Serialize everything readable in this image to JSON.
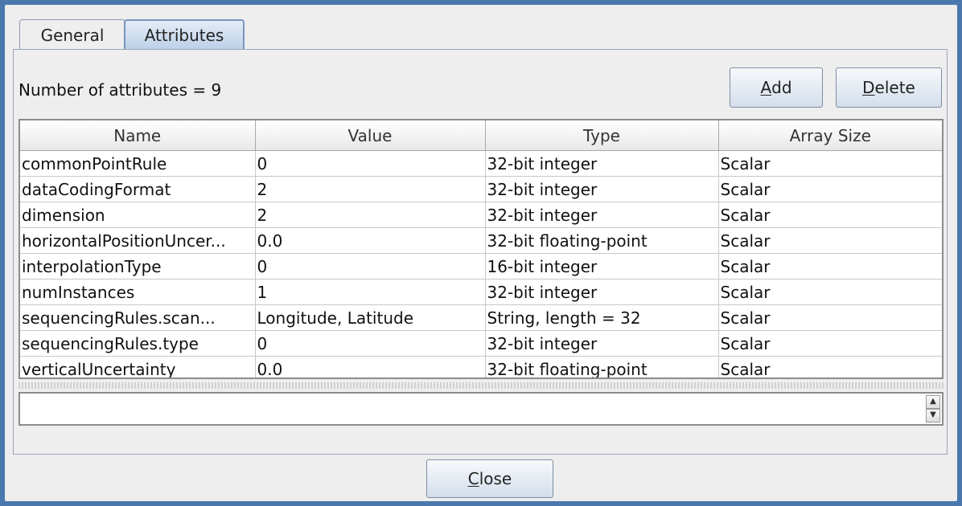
{
  "tabs": [
    {
      "label": "General",
      "active": false
    },
    {
      "label": "Attributes",
      "active": true
    }
  ],
  "count_label": "Number of attributes = 9",
  "buttons": {
    "add": {
      "mnemonic": "A",
      "rest": "dd"
    },
    "delete": {
      "mnemonic": "D",
      "rest": "elete"
    },
    "close": {
      "mnemonic": "C",
      "rest": "lose"
    }
  },
  "table": {
    "columns": [
      "Name",
      "Value",
      "Type",
      "Array Size"
    ],
    "rows": [
      [
        "commonPointRule",
        "0",
        "32-bit integer",
        "Scalar"
      ],
      [
        "dataCodingFormat",
        "2",
        "32-bit integer",
        "Scalar"
      ],
      [
        "dimension",
        "2",
        "32-bit integer",
        "Scalar"
      ],
      [
        "horizontalPositionUncer...",
        "0.0",
        "32-bit floating-point",
        "Scalar"
      ],
      [
        "interpolationType",
        "0",
        "16-bit integer",
        "Scalar"
      ],
      [
        "numInstances",
        "1",
        "32-bit integer",
        "Scalar"
      ],
      [
        "sequencingRules.scan...",
        "Longitude, Latitude",
        "String, length = 32",
        "Scalar"
      ],
      [
        "sequencingRules.type",
        "0",
        "32-bit integer",
        "Scalar"
      ],
      [
        "verticalUncertainty",
        "0.0",
        "32-bit floating-point",
        "Scalar"
      ]
    ]
  },
  "spinner": {
    "up": "▲",
    "down": "▼"
  }
}
